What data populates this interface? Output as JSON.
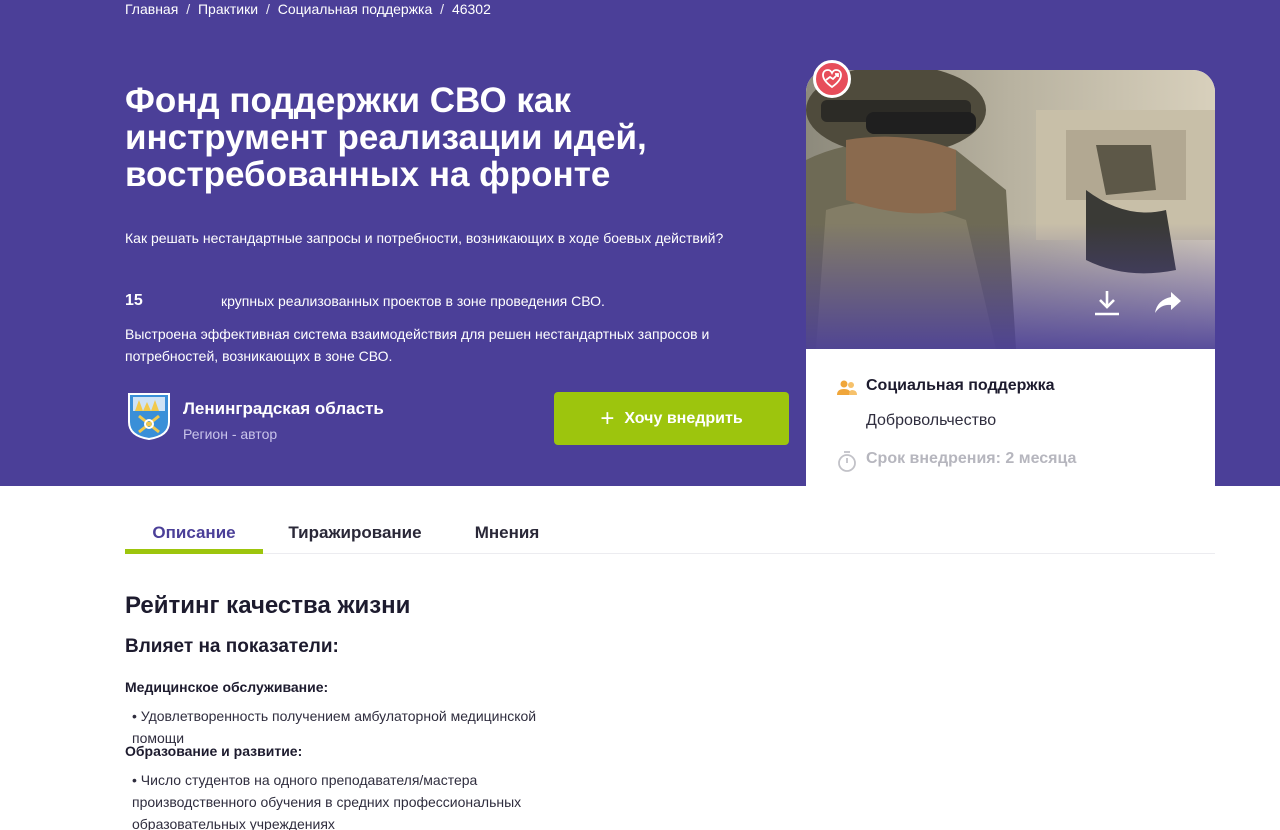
{
  "breadcrumb": {
    "home": "Главная",
    "sep": "/",
    "practices": "Практики",
    "category": "Социальная поддержка",
    "id_sep": "/",
    "id": "46302"
  },
  "hero": {
    "title": "Фонд поддержки СВО как инструмент реализации идей, востребованных на фронте",
    "subtitle": "Как решать нестандартные запросы и потребности, возникающих в ходе боевых действий?",
    "stat_number": "15",
    "stat_text": "крупных реализованных проектов в зоне проведения СВО.",
    "description": "Выстроена эффективная система взаимодействия для решен нестандартных запросов и потребностей, возникающих в зоне СВО."
  },
  "author": {
    "name": "Ленинградская область",
    "role": "Регион - автор"
  },
  "actions": {
    "implement_label": "Хочу внедрить",
    "implement_icon": "plus-icon"
  },
  "card": {
    "badge_icon": "heart-trend-icon",
    "download_icon": "download-icon",
    "share_icon": "share-icon",
    "category": "Социальная поддержка",
    "subcategory": "Добровольчество",
    "term": "Срок внедрения: 2 месяца"
  },
  "tabs": [
    {
      "label": "Описание",
      "active": true
    },
    {
      "label": "Тиражирование",
      "active": false
    },
    {
      "label": "Мнения",
      "active": false
    }
  ],
  "content": {
    "rating_title": "Рейтинг качества жизни",
    "affects_title": "Влияет на показатели:",
    "categories": [
      {
        "title": "Медицинское обслуживание:",
        "items": [
          "• Удовлетворенность получением амбулаторной медицинской помощи"
        ]
      },
      {
        "title": "Образование и развитие:",
        "items": [
          "• Число студентов на одного преподавателя/мастера производственного обучения в средних профессиональных образовательных учреждениях"
        ]
      }
    ]
  },
  "colors": {
    "hero_bg": "#4b3f98",
    "accent_green": "#9dc50d",
    "badge_red": "#e74d5a"
  }
}
